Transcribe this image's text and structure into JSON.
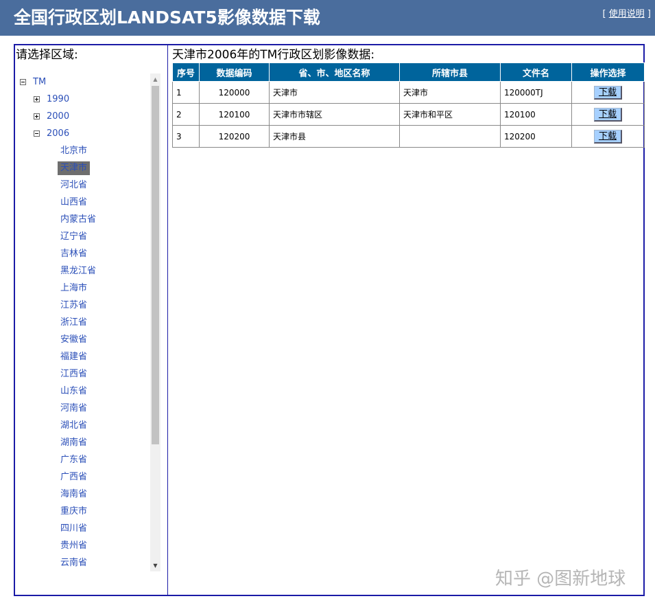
{
  "header": {
    "title": "全国行政区划LANDSAT5影像数据下载",
    "help_link": "使用说明",
    "help_bracket_open": "[ ",
    "help_bracket_close": " ]",
    "background": "#4a6d9d"
  },
  "left_panel": {
    "prompt": "请选择区域:",
    "tree": {
      "root": "TM",
      "years": [
        "1990",
        "2000",
        "2006"
      ],
      "expanded_year": "2006",
      "selected": "天津市",
      "provinces": [
        "北京市",
        "天津市",
        "河北省",
        "山西省",
        "内蒙古省",
        "辽宁省",
        "吉林省",
        "黑龙江省",
        "上海市",
        "江苏省",
        "浙江省",
        "安徽省",
        "福建省",
        "江西省",
        "山东省",
        "河南省",
        "湖北省",
        "湖南省",
        "广东省",
        "广西省",
        "海南省",
        "重庆市",
        "四川省",
        "贵州省",
        "云南省"
      ]
    }
  },
  "right_panel": {
    "heading": "天津市2006年的TM行政区划影像数据:",
    "table": {
      "headers": [
        "序号",
        "数据编码",
        "省、市、地区名称",
        "所辖市县",
        "文件名",
        "操作选择"
      ],
      "header_color": "#00649c",
      "rows": [
        {
          "index": "1",
          "code": "120000",
          "name": "天津市",
          "county": "天津市",
          "file": "120000TJ",
          "action": "下载"
        },
        {
          "index": "2",
          "code": "120100",
          "name": "天津市市辖区",
          "county": "天津市和平区",
          "file": "120100",
          "action": "下载"
        },
        {
          "index": "3",
          "code": "120200",
          "name": "天津市县",
          "county": "",
          "file": "120200",
          "action": "下载"
        }
      ]
    }
  },
  "watermark": "知乎 @图新地球",
  "colors": {
    "frame_border": "#1a1aa6",
    "link": "#2b4fb8",
    "button": "#a6d0ff"
  }
}
